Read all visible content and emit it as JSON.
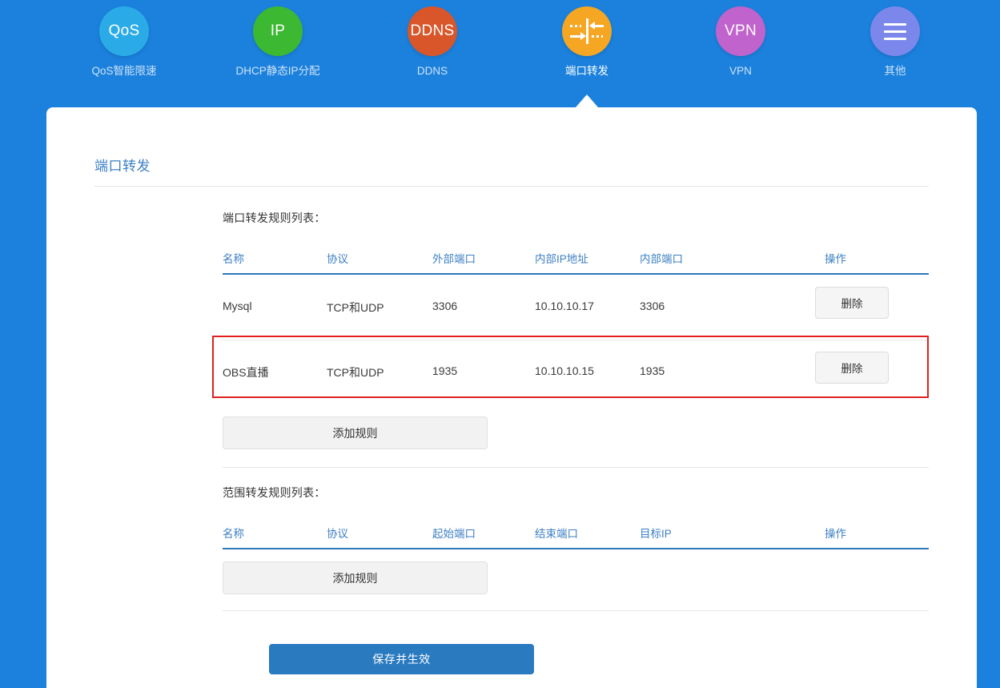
{
  "nav": {
    "items": [
      {
        "label": "QoS智能限速",
        "icon_text": "QoS",
        "icon_name": "qos-icon",
        "color": "#2aabe8",
        "active": false
      },
      {
        "label": "DHCP静态IP分配",
        "icon_text": "IP",
        "icon_name": "ip-icon",
        "color": "#3cb832",
        "active": false
      },
      {
        "label": "DDNS",
        "icon_text": "DDNS",
        "icon_name": "ddns-icon",
        "color": "#d9562a",
        "active": false
      },
      {
        "label": "端口转发",
        "icon_text": "",
        "icon_name": "port-forward-icon",
        "color": "#f5a623",
        "active": true
      },
      {
        "label": "VPN",
        "icon_text": "VPN",
        "icon_name": "vpn-icon",
        "color": "#c063cc",
        "active": false
      },
      {
        "label": "其他",
        "icon_text": "",
        "icon_name": "hamburger-menu-icon",
        "color": "#7b87ea",
        "active": false
      }
    ]
  },
  "page": {
    "title": "端口转发"
  },
  "port_forward": {
    "section_label": "端口转发规则列表：",
    "headers": [
      "名称",
      "协议",
      "外部端口",
      "内部IP地址",
      "内部端口",
      "操作"
    ],
    "rows": [
      {
        "name": "Mysql",
        "protocol": "TCP和UDP",
        "external_port": "3306",
        "internal_ip": "10.10.10.17",
        "internal_port": "3306",
        "action_label": "删除",
        "highlighted": false
      },
      {
        "name": "OBS直播",
        "protocol": "TCP和UDP",
        "external_port": "1935",
        "internal_ip": "10.10.10.15",
        "internal_port": "1935",
        "action_label": "删除",
        "highlighted": true
      }
    ],
    "add_label": "添加规则"
  },
  "range_forward": {
    "section_label": "范围转发规则列表：",
    "headers": [
      "名称",
      "协议",
      "起始端口",
      "结束端口",
      "目标IP",
      "操作"
    ],
    "rows": [],
    "add_label": "添加规则"
  },
  "footer": {
    "save_label": "保存并生效"
  },
  "colors": {
    "page_background": "#1b81dd",
    "accent": "#3c7fc4",
    "table_rule": "#2f77bd",
    "highlight_border": "#e02020",
    "save_button": "#2a7ac0"
  }
}
